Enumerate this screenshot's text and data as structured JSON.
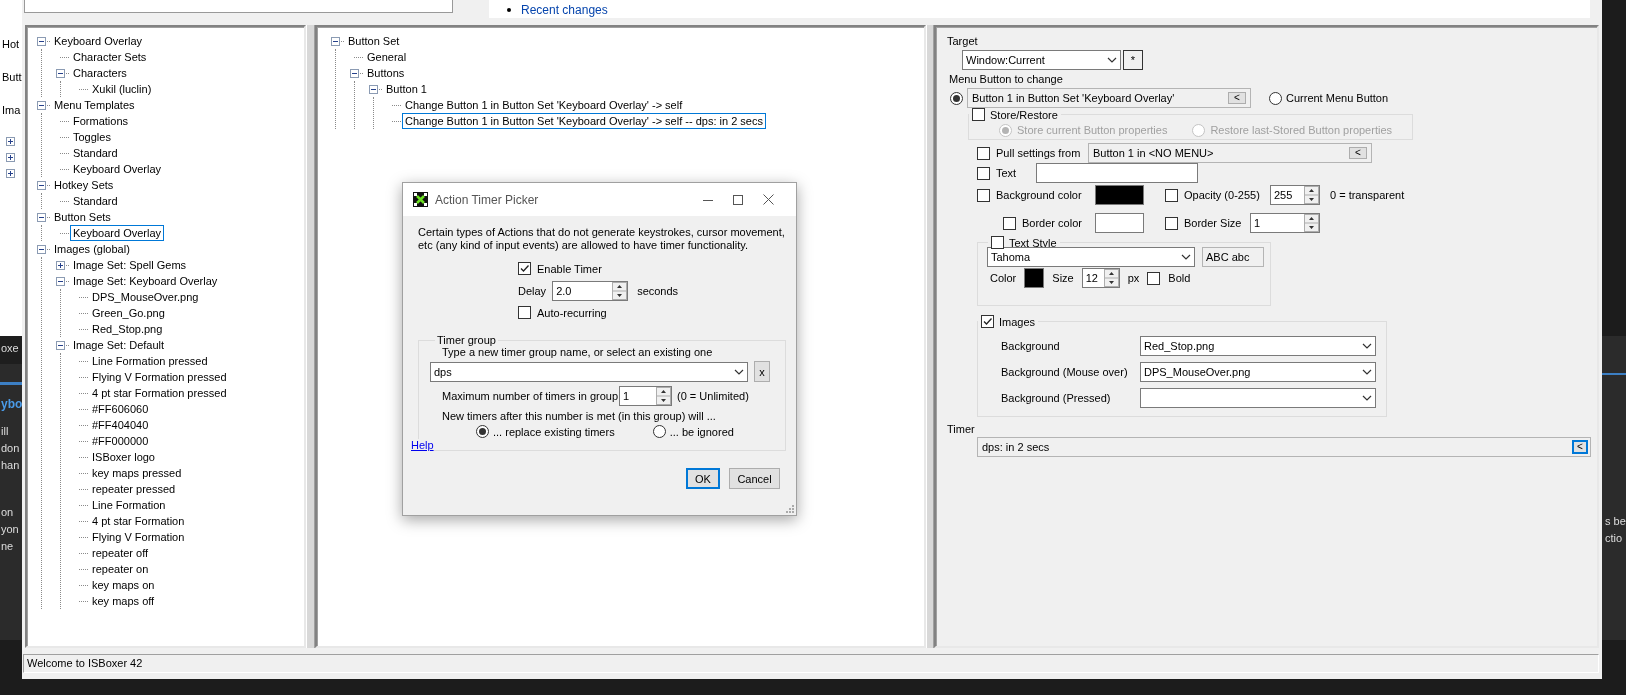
{
  "background": {
    "top_link": "Recent changes",
    "left_tree": [
      "Hot",
      "Butt",
      "Ima"
    ],
    "left_tab": "oxe",
    "left_heading": "ybo",
    "left_lines": [
      "ill",
      "don",
      "han",
      "on",
      "yon",
      "ne"
    ],
    "right_lines": [
      "s be",
      "ctio"
    ]
  },
  "tree": [
    {
      "label": "Keyboard Overlay",
      "selected": false,
      "expanded": true,
      "children": [
        {
          "label": "Character Sets",
          "selected": false
        },
        {
          "label": "Characters",
          "selected": false,
          "expanded": true,
          "children": [
            {
              "label": "Xukil (luclin)",
              "selected": false
            }
          ]
        }
      ]
    },
    {
      "label": "Menu Templates",
      "selected": false,
      "expanded": true,
      "children": [
        {
          "label": "Formations",
          "selected": false
        },
        {
          "label": "Toggles",
          "selected": false
        },
        {
          "label": "Standard",
          "selected": false
        },
        {
          "label": "Keyboard Overlay",
          "selected": false
        }
      ]
    },
    {
      "label": "Hotkey Sets",
      "selected": false,
      "expanded": true,
      "children": [
        {
          "label": "Standard",
          "selected": false
        }
      ]
    },
    {
      "label": "Button Sets",
      "selected": false,
      "expanded": true,
      "children": [
        {
          "label": "Keyboard Overlay",
          "selected": true
        }
      ]
    },
    {
      "label": "Images (global)",
      "selected": false,
      "expanded": true,
      "children": [
        {
          "label": "Image Set: Spell Gems",
          "selected": false,
          "expanded": false
        },
        {
          "label": "Image Set: Keyboard Overlay",
          "selected": false,
          "expanded": true,
          "children": [
            {
              "label": "DPS_MouseOver.png",
              "selected": false
            },
            {
              "label": "Green_Go.png",
              "selected": false
            },
            {
              "label": "Red_Stop.png",
              "selected": false
            }
          ]
        },
        {
          "label": "Image Set: Default",
          "selected": false,
          "expanded": true,
          "children": [
            {
              "label": "Line Formation pressed",
              "selected": false
            },
            {
              "label": "Flying V Formation pressed",
              "selected": false
            },
            {
              "label": "4 pt star Formation pressed",
              "selected": false
            },
            {
              "label": "#FF606060",
              "selected": false
            },
            {
              "label": "#FF404040",
              "selected": false
            },
            {
              "label": "#FF000000",
              "selected": false
            },
            {
              "label": "ISBoxer logo",
              "selected": false
            },
            {
              "label": "key maps pressed",
              "selected": false
            },
            {
              "label": "repeater pressed",
              "selected": false
            },
            {
              "label": "Line Formation",
              "selected": false
            },
            {
              "label": "4 pt star Formation",
              "selected": false
            },
            {
              "label": "Flying V Formation",
              "selected": false
            },
            {
              "label": "repeater off",
              "selected": false
            },
            {
              "label": "repeater on",
              "selected": false
            },
            {
              "label": "key maps on",
              "selected": false
            },
            {
              "label": "key maps off",
              "selected": false
            }
          ]
        }
      ]
    }
  ],
  "button_set_tree": [
    {
      "label": "Button Set",
      "selected": false,
      "expanded": true,
      "children": [
        {
          "label": "General",
          "selected": false
        },
        {
          "label": "Buttons",
          "selected": false,
          "expanded": true,
          "children": [
            {
              "label": "Button 1",
              "selected": false,
              "expanded": true,
              "children": [
                {
                  "label": "Change Button 1 in Button Set 'Keyboard Overlay' -> self",
                  "selected": false
                },
                {
                  "label": "Change Button 1 in Button Set 'Keyboard Overlay' -> self -- dps: in 2 secs",
                  "selected": true
                }
              ]
            }
          ]
        }
      ]
    }
  ],
  "properties": {
    "target": {
      "label": "Target",
      "value": "Window:Current",
      "button": "*"
    },
    "menu_button": {
      "label": "Menu Button to change",
      "options": [
        {
          "kind": "picker",
          "value": "Button 1 in Button Set 'Keyboard Overlay'",
          "button": "<",
          "selected": true
        },
        {
          "kind": "plain",
          "label": "Current Menu Button",
          "selected": false
        }
      ]
    },
    "store_restore": {
      "label": "Store/Restore",
      "checked": false,
      "disabled": true,
      "options": [
        {
          "label": "Store current Button properties",
          "selected": true
        },
        {
          "label": "Restore last-Stored Button properties",
          "selected": false
        }
      ]
    },
    "pull": {
      "label": "Pull settings from",
      "checked": false,
      "value": "Button 1 in <NO MENU>",
      "button": "<"
    },
    "text": {
      "label": "Text",
      "checked": false
    },
    "background_color": {
      "label": "Background color",
      "checked": false,
      "color": "#000000"
    },
    "opacity": {
      "label": "Opacity (0-255)",
      "checked": false,
      "value": "255",
      "note": "0 = transparent"
    },
    "border_color": {
      "label": "Border color",
      "checked": false,
      "color": "#ffffff"
    },
    "border_size": {
      "label": "Border Size",
      "checked": false,
      "value": "1"
    },
    "text_style": {
      "label": "Text Style",
      "checked": false,
      "font": "Tahoma",
      "preview": "ABC abc",
      "color_label": "Color",
      "color": "#000000",
      "size_label": "Size",
      "size": "12",
      "unit": "px",
      "bold": {
        "label": "Bold",
        "checked": false
      }
    },
    "images": {
      "label": "Images",
      "checked": true,
      "rows": [
        {
          "label": "Background",
          "value": "Red_Stop.png"
        },
        {
          "label": "Background (Mouse over)",
          "value": "DPS_MouseOver.png"
        },
        {
          "label": "Background (Pressed)"
        }
      ]
    },
    "timer": {
      "label": "Timer",
      "value": "dps: in 2 secs",
      "button": "<"
    }
  },
  "dialog": {
    "title": "Action Timer Picker",
    "description": "Certain types of Actions that do not generate keystrokes, cursor movement, etc (any kind of input events) are allowed to have timer functionality.",
    "enable_timer": {
      "label": "Enable Timer",
      "checked": true
    },
    "delay": {
      "label": "Delay",
      "value": "2.0",
      "unit": "seconds"
    },
    "auto_recurring": {
      "label": "Auto-recurring",
      "checked": false
    },
    "timer_group": {
      "legend": "Timer group",
      "prompt": "Type a new timer group name, or select an existing one",
      "value": "dps",
      "clear": "x",
      "max_label": "Maximum number of timers in group",
      "max_value": "1",
      "max_note": "(0 = Unlimited)",
      "policy_prompt": "New timers after this number is met (in this group) will ...",
      "options": [
        {
          "label": "... replace existing timers",
          "selected": true
        },
        {
          "label": "... be ignored",
          "selected": false
        }
      ]
    },
    "help": "Help",
    "buttons": [
      {
        "label": "OK",
        "default": true
      },
      {
        "label": "Cancel",
        "default": false
      }
    ]
  },
  "status_bar": "Welcome to ISBoxer 42"
}
